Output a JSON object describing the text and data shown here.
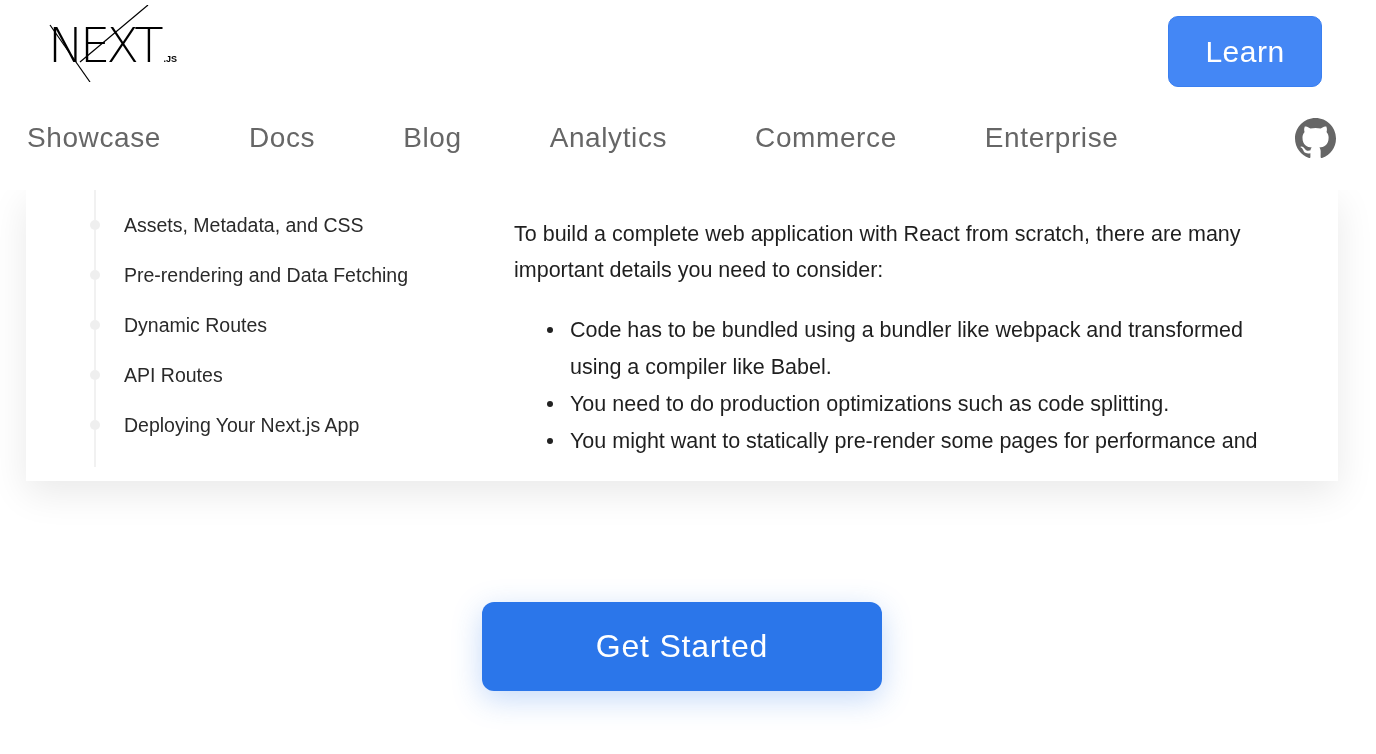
{
  "header": {
    "logo": {
      "wordmark": "NEXT",
      "suffix": ".JS"
    },
    "learn_button": "Learn"
  },
  "nav": {
    "links": [
      "Showcase",
      "Docs",
      "Blog",
      "Analytics",
      "Commerce",
      "Enterprise"
    ]
  },
  "preview": {
    "toc": [
      "Assets, Metadata, and CSS",
      "Pre-rendering and Data Fetching",
      "Dynamic Routes",
      "API Routes",
      "Deploying Your Next.js App"
    ],
    "article": {
      "intro": "To build a complete web application with React from scratch, there are many important details you need to consider:",
      "bullets": [
        "Code has to be bundled using a bundler like webpack and transformed using a compiler like Babel.",
        "You need to do production optimizations such as code splitting.",
        "You might want to statically pre-render some pages for performance and"
      ]
    }
  },
  "cta": {
    "label": "Get Started"
  }
}
